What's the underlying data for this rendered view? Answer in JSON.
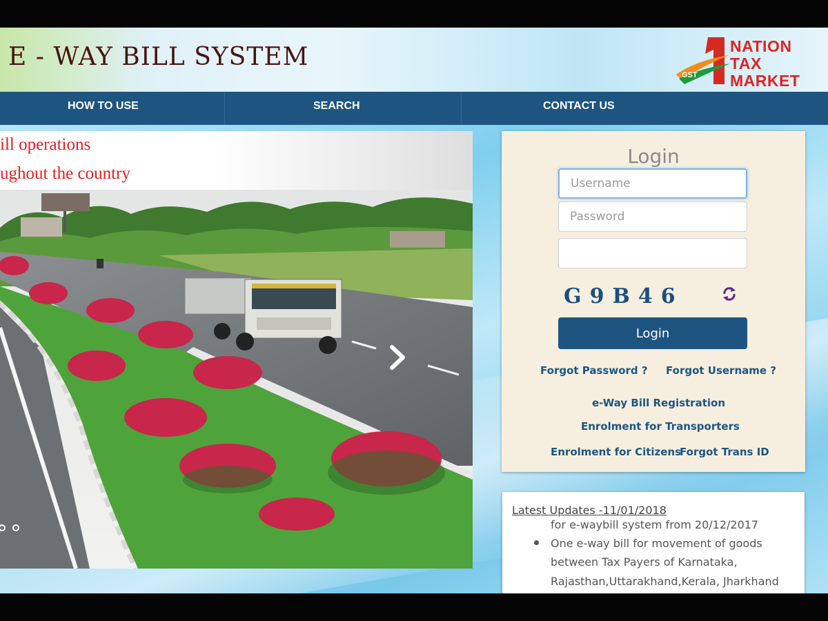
{
  "header": {
    "title": "E - WAY BILL SYSTEM",
    "brand_badge": "GST",
    "brand_lines": [
      "NATION",
      "TAX",
      "MARKET"
    ]
  },
  "nav": {
    "items": [
      "HOW TO USE",
      "SEARCH",
      "CONTACT US"
    ]
  },
  "banner": {
    "text_lines": [
      "ill operations",
      "ughout the country"
    ]
  },
  "login": {
    "title": "Login",
    "username_placeholder": "Username",
    "password_placeholder": "Password",
    "captcha_text": "G9B46",
    "button_label": "Login",
    "links": {
      "forgot_password": "Forgot Password ?",
      "forgot_username": "Forgot Username ?",
      "registration": "e-Way Bill Registration",
      "transporters": "Enrolment for Transporters",
      "citizens": "Enrolment for Citizens",
      "forgot_trans_id": "Forgot Trans ID"
    }
  },
  "updates": {
    "heading": "Latest Updates -11/01/2018",
    "lines": [
      "for e-waybill system from 20/12/2017",
      "One e-way bill for movement of goods",
      "between Tax Payers of Karnataka,",
      "Rajasthan,Uttarakhand,Kerala, Jharkhand"
    ]
  },
  "colors": {
    "nav_bg": "#1d5580",
    "title_color": "#4a1410",
    "banner_text": "#e61d1d",
    "link_color": "#1d5580",
    "panel_bg": "#f6efe0"
  },
  "icons": [
    "chevron-down-icon",
    "chevron-right-icon",
    "refresh-icon",
    "gst-logo-icon"
  ]
}
